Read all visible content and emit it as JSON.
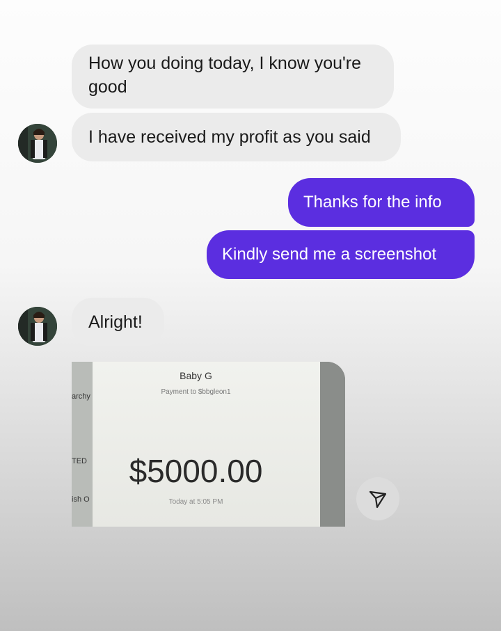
{
  "messages": {
    "m1": "How you doing today, I know you're good",
    "m2": "I have received my profit as you said",
    "m3": "Thanks for the info",
    "m4": "Kindly send me a screenshot",
    "m5": "Alright!"
  },
  "screenshot": {
    "name": "Baby G",
    "subtitle": "Payment to $bbgleon1",
    "amount": "$5000.00",
    "time": "Today at 5:05 PM",
    "cut_left": [
      "archy",
      "TED",
      "ish O"
    ]
  },
  "colors": {
    "outgoing_bubble": "#5b2ee0",
    "incoming_bubble": "#ebebeb"
  },
  "icons": {
    "send": "send-icon",
    "avatar": "avatar"
  }
}
